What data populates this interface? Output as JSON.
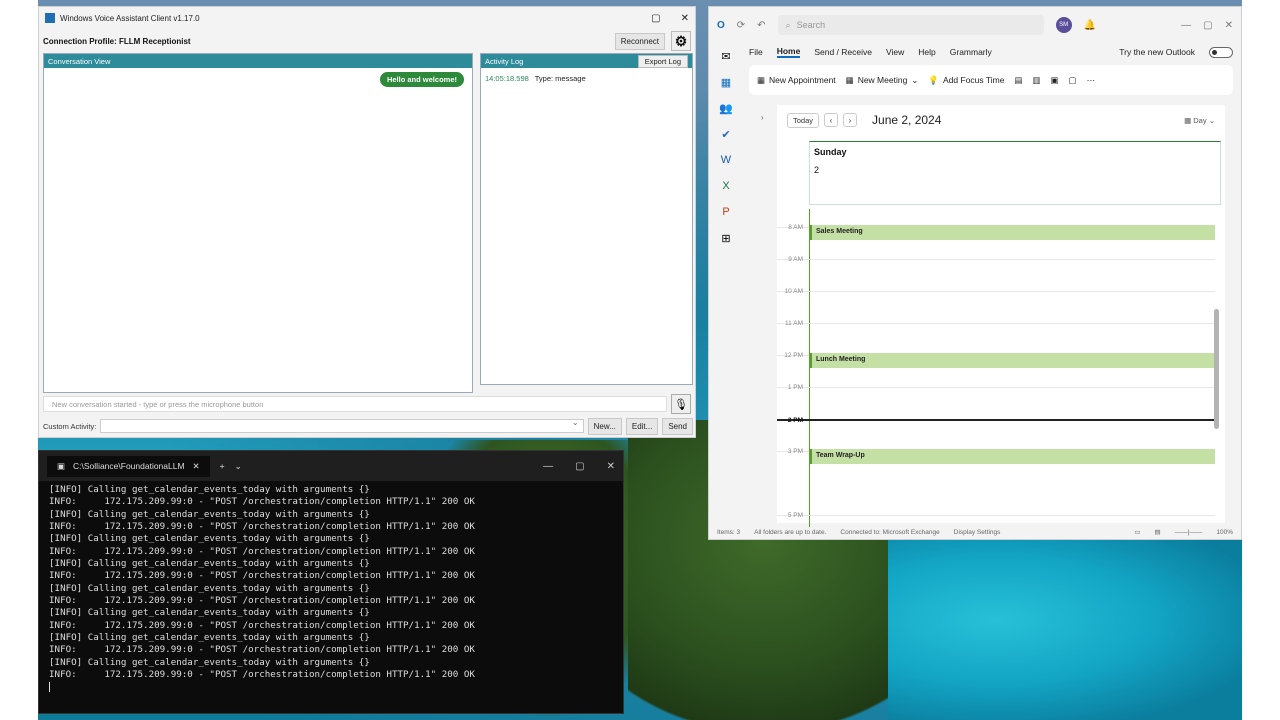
{
  "voice": {
    "title": "Windows Voice Assistant Client v1.17.0",
    "profile_label": "Connection Profile: FLLM Receptionist",
    "reconnect_label": "Reconnect",
    "conversation_title": "Conversation View",
    "activity_title": "Activity Log",
    "export_label": "Export Log",
    "bubble_text": "Hello and welcome!",
    "log_timestamp": "14:05:18.598",
    "log_type": "Type: message",
    "input_placeholder": "New conversation started - type or press the microphone button",
    "custom_activity_label": "Custom Activity:",
    "new_label": "New...",
    "edit_label": "Edit...",
    "send_label": "Send"
  },
  "outlook": {
    "search_placeholder": "Search",
    "avatar_initials": "SM",
    "menu": [
      "File",
      "Home",
      "Send / Receive",
      "View",
      "Help",
      "Grammarly"
    ],
    "try_new": "Try the new Outlook",
    "toggle_state": "Off",
    "new_appointment": "New Appointment",
    "new_meeting": "New Meeting",
    "add_focus": "Add Focus Time",
    "today": "Today",
    "date": "June 2, 2024",
    "view": "Day",
    "day_name": "Sunday",
    "day_number": "2",
    "hours": [
      "8 AM",
      "9 AM",
      "10 AM",
      "11 AM",
      "12 PM",
      "1 PM",
      "2 PM",
      "3 PM",
      "5 PM"
    ],
    "events": [
      "Sales Meeting",
      "Lunch Meeting",
      "Team Wrap-Up"
    ],
    "status": {
      "items": "Items: 3",
      "folders": "All folders are up to date.",
      "connected": "Connected to: Microsoft Exchange",
      "display": "Display Settings",
      "zoom": "100%"
    }
  },
  "terminal": {
    "tab_title": "C:\\Solliance\\FoundationaLLM",
    "lines": [
      "[INFO] Calling get_calendar_events_today with arguments {}",
      "INFO:     172.175.209.99:0 - \"POST /orchestration/completion HTTP/1.1\" 200 OK",
      "[INFO] Calling get_calendar_events_today with arguments {}",
      "INFO:     172.175.209.99:0 - \"POST /orchestration/completion HTTP/1.1\" 200 OK",
      "[INFO] Calling get_calendar_events_today with arguments {}",
      "INFO:     172.175.209.99:0 - \"POST /orchestration/completion HTTP/1.1\" 200 OK",
      "[INFO] Calling get_calendar_events_today with arguments {}",
      "INFO:     172.175.209.99:0 - \"POST /orchestration/completion HTTP/1.1\" 200 OK",
      "[INFO] Calling get_calendar_events_today with arguments {}",
      "INFO:     172.175.209.99:0 - \"POST /orchestration/completion HTTP/1.1\" 200 OK",
      "[INFO] Calling get_calendar_events_today with arguments {}",
      "INFO:     172.175.209.99:0 - \"POST /orchestration/completion HTTP/1.1\" 200 OK",
      "[INFO] Calling get_calendar_events_today with arguments {}",
      "INFO:     172.175.209.99:0 - \"POST /orchestration/completion HTTP/1.1\" 200 OK",
      "[INFO] Calling get_calendar_events_today with arguments {}",
      "INFO:     172.175.209.99:0 - \"POST /orchestration/completion HTTP/1.1\" 200 OK"
    ]
  }
}
